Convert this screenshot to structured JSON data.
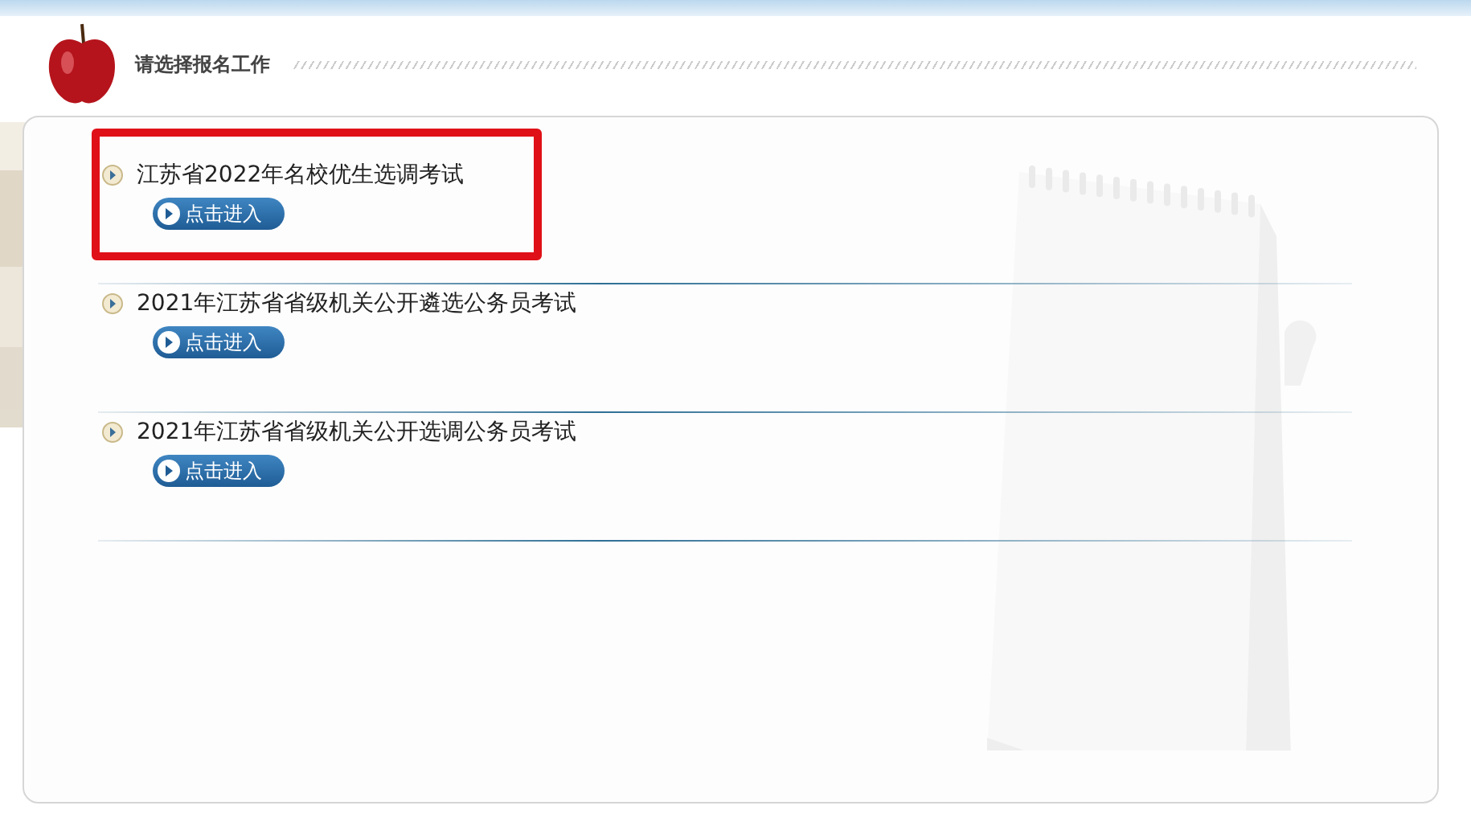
{
  "header": {
    "title": "请选择报名工作"
  },
  "exams": [
    {
      "title": "江苏省2022年名校优生选调考试",
      "button": "点击进入",
      "highlighted": true
    },
    {
      "title": "2021年江苏省省级机关公开遴选公务员考试",
      "button": "点击进入",
      "highlighted": false
    },
    {
      "title": "2021年江苏省省级机关公开选调公务员考试",
      "button": "点击进入",
      "highlighted": false
    }
  ]
}
